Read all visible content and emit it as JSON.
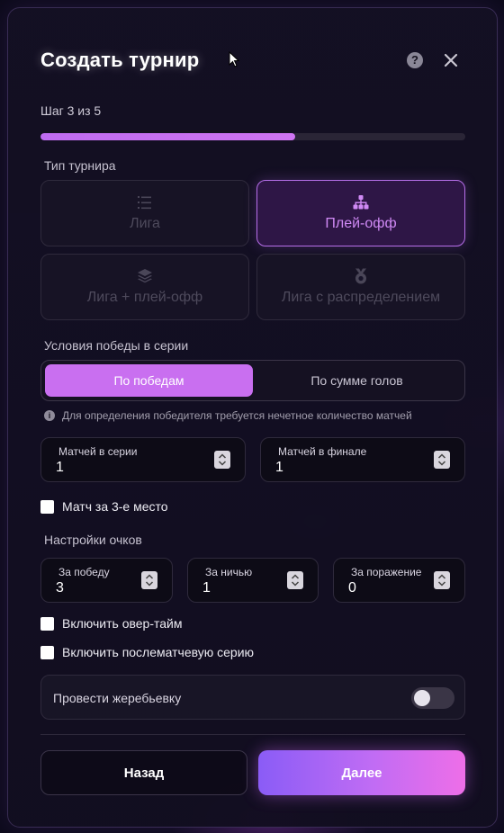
{
  "header": {
    "title": "Создать турнир"
  },
  "progress": {
    "step_label": "Шаг 3 из 5",
    "fraction": 0.6
  },
  "tournament_type": {
    "label": "Тип турнира",
    "options": [
      {
        "label": "Лига",
        "icon": "list-icon",
        "selected": false
      },
      {
        "label": "Плей-офф",
        "icon": "bracket-icon",
        "selected": true
      },
      {
        "label": "Лига + плей-офф",
        "icon": "layers-icon",
        "selected": false
      },
      {
        "label": "Лига с распределением",
        "icon": "medal-icon",
        "selected": false
      }
    ]
  },
  "series_win": {
    "label": "Условия победы в серии",
    "options": [
      "По победам",
      "По сумме голов"
    ],
    "selected": "По победам",
    "info": "Для определения победителя требуется нечетное количество матчей"
  },
  "series_fields": {
    "matches_in_series": {
      "label": "Матчей в серии",
      "value": "1"
    },
    "matches_in_final": {
      "label": "Матчей в финале",
      "value": "1"
    }
  },
  "third_place": {
    "label": "Матч за 3-е место",
    "checked": false
  },
  "points": {
    "label": "Настройки очков",
    "win": {
      "label": "За победу",
      "value": "3"
    },
    "draw": {
      "label": "За ничью",
      "value": "1"
    },
    "loss": {
      "label": "За поражение",
      "value": "0"
    }
  },
  "overtime": {
    "label": "Включить овер-тайм",
    "checked": false
  },
  "shootout": {
    "label": "Включить послематчевую серию",
    "checked": false
  },
  "draw_lots": {
    "label": "Провести жеребьевку",
    "on": false
  },
  "footer": {
    "back_label": "Назад",
    "next_label": "Далее"
  },
  "colors": {
    "accent": "#c96ff0",
    "accent_gradient_start": "#8a5cf6",
    "accent_gradient_end": "#ee6ee8"
  }
}
